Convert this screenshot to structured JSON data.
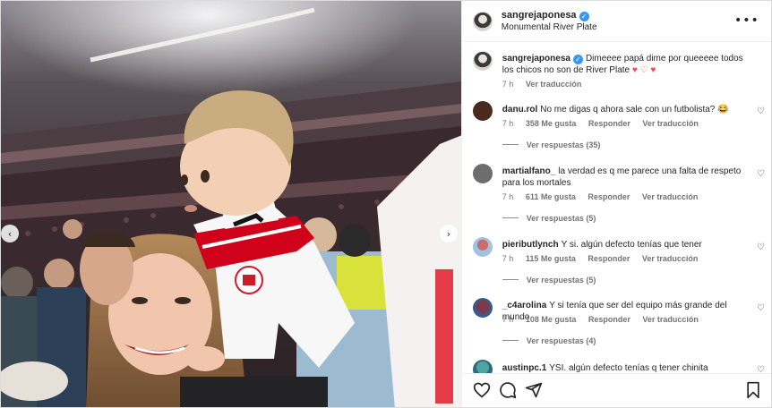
{
  "post": {
    "username": "sangrejaponesa",
    "location": "Monumental River Plate",
    "caption": "Dimeeee papá dime por queeeee todos los chicos no son de River Plate",
    "caption_emojis": "♥ ♡ ♥",
    "time": "7 h",
    "translate": "Ver traducción"
  },
  "comments": [
    {
      "user": "danu.rol",
      "text": "No me digas q ahora sale con un futbolista? 😂",
      "time": "7 h",
      "likes": "358 Me gusta",
      "reply": "Responder",
      "translate": "Ver traducción",
      "replies": "Ver respuestas (35)"
    },
    {
      "user": "martialfano_",
      "text": "la verdad es q me parece una falta de respeto para los mortales",
      "time": "7 h",
      "likes": "611 Me gusta",
      "reply": "Responder",
      "translate": "Ver traducción",
      "replies": "Ver respuestas (5)"
    },
    {
      "user": "pieributlynch",
      "text": "Y si. algún defecto tenías que tener",
      "time": "7 h",
      "likes": "115 Me gusta",
      "reply": "Responder",
      "translate": "Ver traducción",
      "replies": "Ver respuestas (5)"
    },
    {
      "user": "_c4arolina",
      "text": "Y si tenía que ser del equipo más grande del mundo",
      "time": "7 h",
      "likes": "108 Me gusta",
      "reply": "Responder",
      "translate": "Ver traducción",
      "replies": "Ver respuestas (4)"
    },
    {
      "user": "austinpc.1",
      "text": "YSI. algún defecto tenías q tener chinita"
    }
  ],
  "icons": {
    "more": "more-options-icon",
    "like": "heart-icon",
    "comment": "comment-icon",
    "share": "share-icon",
    "save": "bookmark-icon"
  },
  "colors": {
    "verified": "#3897f0",
    "river_red": "#d0021b",
    "muted_text": "#737373"
  }
}
